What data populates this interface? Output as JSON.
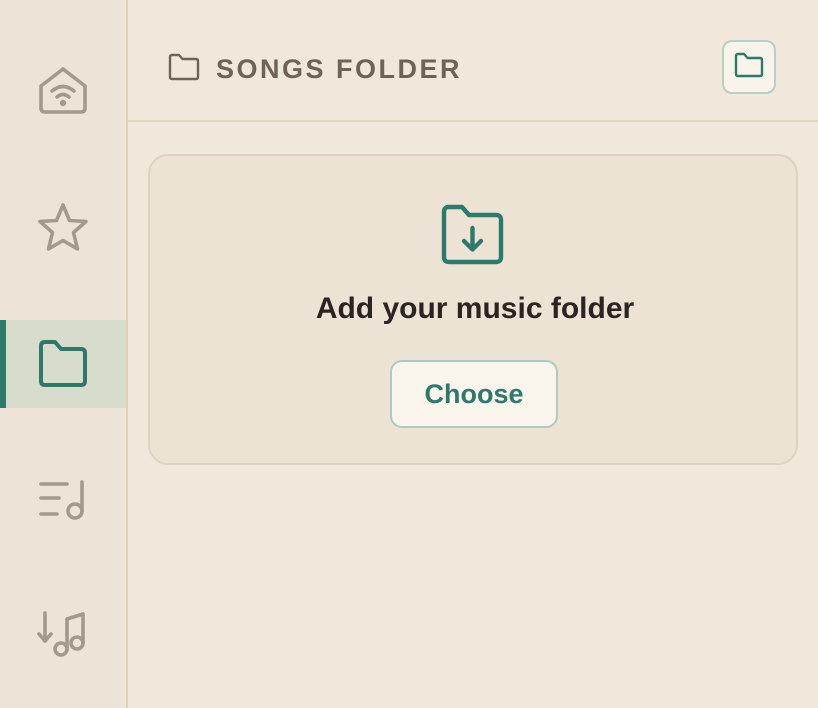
{
  "sidebar": {
    "items": [
      {
        "icon": "home-wifi-icon",
        "active": false
      },
      {
        "icon": "star-icon",
        "active": false
      },
      {
        "icon": "folder-icon",
        "active": true
      },
      {
        "icon": "playlist-music-icon",
        "active": false
      },
      {
        "icon": "sort-music-icon",
        "active": false
      }
    ]
  },
  "header": {
    "icon": "folder-icon",
    "title": "SONGS FOLDER",
    "action_icon": "folder-icon"
  },
  "empty_state": {
    "icon": "folder-download-icon",
    "title": "Add your music folder",
    "button_label": "Choose"
  },
  "colors": {
    "accent": "#2d7a6b",
    "sidebar_bg": "#ede3d6",
    "main_bg": "#f1e8dc",
    "card_bg": "#ede3d4",
    "muted_icon": "#a39a8e",
    "header_text": "#6e6356",
    "title_text": "#2a2520",
    "active_nav_bg": "#d8dccd"
  }
}
